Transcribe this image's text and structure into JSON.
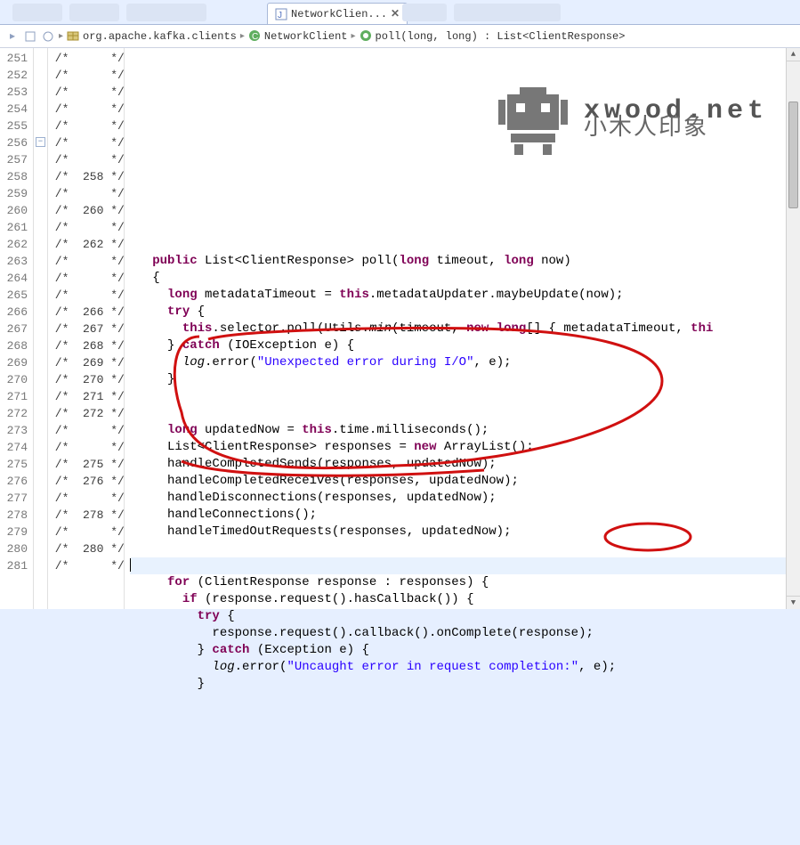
{
  "tab": {
    "label": "NetworkClien...",
    "close": "✕"
  },
  "breadcrumb": {
    "package": "org.apache.kafka.clients",
    "class": "NetworkClient",
    "method": "poll(long, long) : List<ClientResponse>"
  },
  "code_lines": [
    {
      "ln": 251,
      "cov": "/*      */",
      "html": ""
    },
    {
      "ln": 252,
      "cov": "/*      */",
      "html": ""
    },
    {
      "ln": 253,
      "cov": "/*      */",
      "html": ""
    },
    {
      "ln": 254,
      "cov": "/*      */",
      "html": ""
    },
    {
      "ln": 255,
      "cov": "/*      */",
      "html": ""
    },
    {
      "ln": 256,
      "cov": "/*      */",
      "fold": "minus",
      "marker": "warn",
      "html": "   <span class='kw'>public</span> List&lt;ClientResponse&gt; poll(<span class='kw'>long</span> timeout, <span class='kw'>long</span> now)"
    },
    {
      "ln": 257,
      "cov": "/*      */",
      "html": "   {"
    },
    {
      "ln": 258,
      "cov": "/*  258 */",
      "html": "     <span class='kw'>long</span> metadataTimeout = <span class='kw'>this</span>.metadataUpdater.maybeUpdate(now);"
    },
    {
      "ln": 259,
      "cov": "/*      */",
      "html": "     <span class='kw'>try</span> {"
    },
    {
      "ln": 260,
      "cov": "/*  260 */",
      "html": "       <span class='kw'>this</span>.selector.poll(Utils.<span class='it'>min</span>(timeout, <span class='kw'>new</span> <span class='kw'>long</span>[] { metadataTimeout, <span class='kw'>thi</span>"
    },
    {
      "ln": 261,
      "cov": "/*      */",
      "html": "     } <span class='kw'>catch</span> (IOException e) {"
    },
    {
      "ln": 262,
      "cov": "/*  262 */",
      "html": "       <span class='it'>log</span>.error(<span class='str'>\"Unexpected error during I/O\"</span>, e);"
    },
    {
      "ln": 263,
      "cov": "/*      */",
      "html": "     }"
    },
    {
      "ln": 264,
      "cov": "/*      */",
      "html": ""
    },
    {
      "ln": 265,
      "cov": "/*      */",
      "html": ""
    },
    {
      "ln": 266,
      "cov": "/*  266 */",
      "html": "     <span class='kw'>long</span> updatedNow = <span class='kw'>this</span>.time.milliseconds();"
    },
    {
      "ln": 267,
      "cov": "/*  267 */",
      "html": "     List&lt;ClientResponse&gt; responses = <span class='kw'>new</span> ArrayList();"
    },
    {
      "ln": 268,
      "cov": "/*  268 */",
      "html": "     handleCompletedSends(responses, updatedNow);"
    },
    {
      "ln": 269,
      "cov": "/*  269 */",
      "html": "     handleCompletedReceives(responses, updatedNow);"
    },
    {
      "ln": 270,
      "cov": "/*  270 */",
      "html": "     handleDisconnections(responses, updatedNow);"
    },
    {
      "ln": 271,
      "cov": "/*  271 */",
      "html": "     handleConnections();"
    },
    {
      "ln": 272,
      "cov": "/*  272 */",
      "html": "     handleTimedOutRequests(responses, updatedNow);"
    },
    {
      "ln": 273,
      "cov": "/*      */",
      "html": ""
    },
    {
      "ln": 274,
      "cov": "/*      */",
      "hl": true,
      "html": "<span class='cursorbar'></span>"
    },
    {
      "ln": 275,
      "cov": "/*  275 */",
      "html": "     <span class='kw'>for</span> (ClientResponse response : responses) {"
    },
    {
      "ln": 276,
      "cov": "/*  276 */",
      "html": "       <span class='kw'>if</span> (response.request().hasCallback()) {"
    },
    {
      "ln": 277,
      "cov": "/*      */",
      "html": "         <span class='kw'>try</span> {"
    },
    {
      "ln": 278,
      "cov": "/*  278 */",
      "html": "           response.request().callback().onComplete(response);"
    },
    {
      "ln": 279,
      "cov": "/*      */",
      "html": "         } <span class='kw'>catch</span> (Exception e) {"
    },
    {
      "ln": 280,
      "cov": "/*  280 */",
      "html": "           <span class='it'>log</span>.error(<span class='str'>\"Uncaught error in request completion:\"</span>, e);"
    },
    {
      "ln": 281,
      "cov": "/*      */",
      "html": "         }"
    }
  ],
  "watermark": {
    "domain": "xwood.net",
    "chinese": "小木人印象"
  }
}
